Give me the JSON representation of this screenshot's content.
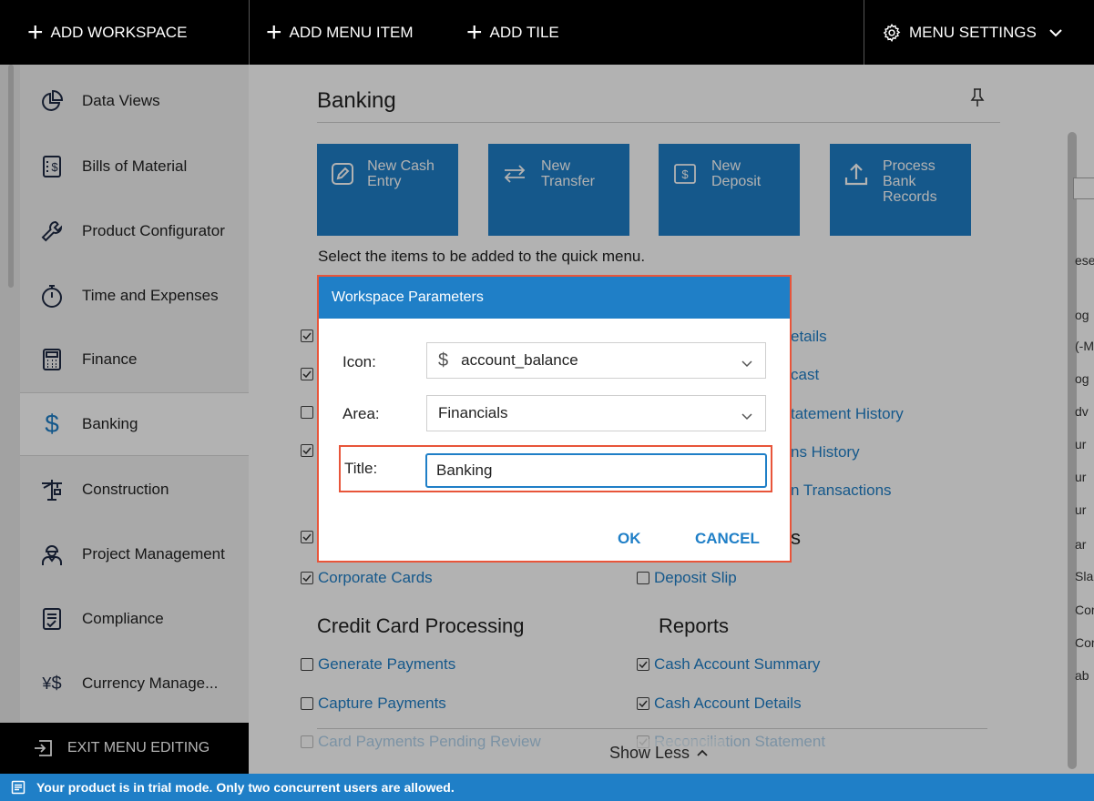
{
  "topbar": {
    "add_workspace": "ADD WORKSPACE",
    "add_menu_item": "ADD MENU ITEM",
    "add_tile": "ADD TILE",
    "menu_settings": "MENU SETTINGS"
  },
  "sidebar": {
    "items": [
      {
        "label": "Data Views",
        "icon": "pie-chart-icon"
      },
      {
        "label": "Bills of Material",
        "icon": "dollar-document-icon"
      },
      {
        "label": "Product Configurator",
        "icon": "wrench-icon"
      },
      {
        "label": "Time and Expenses",
        "icon": "stopwatch-icon"
      },
      {
        "label": "Finance",
        "icon": "calculator-icon"
      },
      {
        "label": "Banking",
        "icon": "dollar-icon",
        "active": true
      },
      {
        "label": "Construction",
        "icon": "crane-icon"
      },
      {
        "label": "Project Management",
        "icon": "worker-icon"
      },
      {
        "label": "Compliance",
        "icon": "checklist-icon"
      },
      {
        "label": "Currency Manage...",
        "icon": "currency-icon"
      }
    ],
    "exit": "EXIT MENU EDITING"
  },
  "main": {
    "title": "Banking",
    "tiles": [
      {
        "label": "New Cash Entry",
        "icon": "pencil-icon"
      },
      {
        "label": "New Transfer",
        "icon": "transfer-arrows-icon"
      },
      {
        "label": "New Deposit",
        "icon": "dollar-box-icon"
      },
      {
        "label": "Process Bank Records",
        "icon": "upload-icon"
      }
    ],
    "hint": "Select the items to be added to the quick menu.",
    "partial_links": {
      "details": "etails",
      "forecast": "cast",
      "statement_history": "tatement History",
      "transactions_history": "ns History",
      "transactions": "n Transactions",
      "section_suffix": "s"
    },
    "corporate_cards": "Corporate Cards",
    "deposit_slip": "Deposit Slip",
    "sections": {
      "credit_card": "Credit Card Processing",
      "reports": "Reports"
    },
    "credit_card_items": [
      {
        "label": "Generate Payments",
        "checked": false
      },
      {
        "label": "Capture Payments",
        "checked": false
      },
      {
        "label": "Card Payments Pending Review",
        "checked": false
      }
    ],
    "report_items": [
      {
        "label": "Cash Account Summary",
        "checked": true
      },
      {
        "label": "Cash Account Details",
        "checked": true
      },
      {
        "label": "Reconciliation Statement",
        "checked": true
      }
    ],
    "show_less": "Show Less"
  },
  "right_strip": {
    "header": "ese",
    "items": [
      "og",
      "(-M",
      "og",
      "dv",
      "ur",
      "ur",
      "ur",
      "ar",
      "Sla",
      "Cor",
      "Cor",
      "ab"
    ]
  },
  "dialog": {
    "title": "Workspace Parameters",
    "icon_label": "Icon:",
    "icon_value": "account_balance",
    "area_label": "Area:",
    "area_value": "Financials",
    "title_label": "Title:",
    "title_value": "Banking",
    "ok": "OK",
    "cancel": "CANCEL"
  },
  "trial": {
    "message": "Your product is in trial mode. Only two concurrent users are allowed."
  },
  "colors": {
    "accent": "#1f7fc7",
    "highlight": "#e8553a",
    "topbar": "#000000"
  }
}
